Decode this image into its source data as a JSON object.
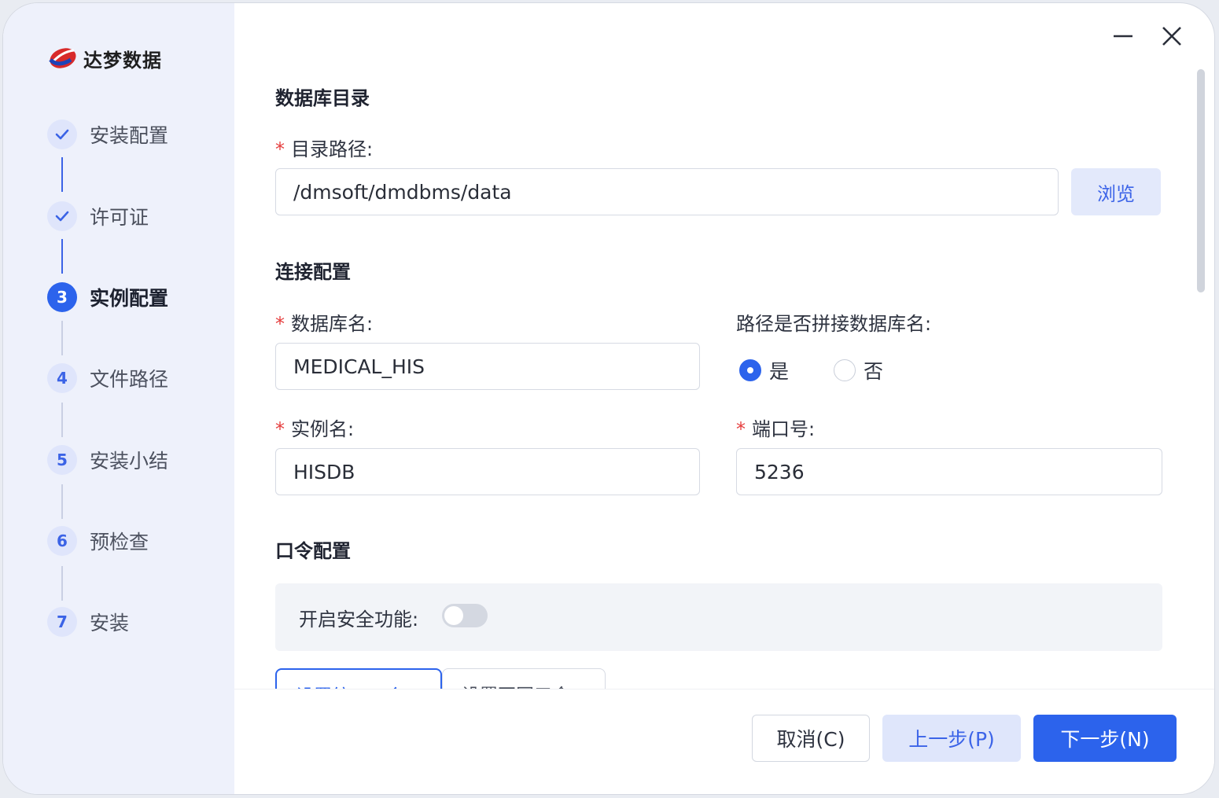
{
  "brand": {
    "name": "达梦数据"
  },
  "steps": [
    {
      "num": "1",
      "label": "安装配置",
      "state": "done"
    },
    {
      "num": "2",
      "label": "许可证",
      "state": "done"
    },
    {
      "num": "3",
      "label": "实例配置",
      "state": "active"
    },
    {
      "num": "4",
      "label": "文件路径",
      "state": "pending"
    },
    {
      "num": "5",
      "label": "安装小结",
      "state": "pending"
    },
    {
      "num": "6",
      "label": "预检查",
      "state": "pending"
    },
    {
      "num": "7",
      "label": "安装",
      "state": "pending"
    }
  ],
  "db_dir": {
    "title": "数据库目录",
    "path_label": "目录路径:",
    "path_value": "/dmsoft/dmdbms/data",
    "browse_label": "浏览"
  },
  "connection": {
    "title": "连接配置",
    "db_name_label": "数据库名:",
    "db_name_value": "MEDICAL_HIS",
    "append_label": "路径是否拼接数据库名:",
    "append_yes": "是",
    "append_no": "否",
    "append_selected": "是",
    "instance_label": "实例名:",
    "instance_value": "HISDB",
    "port_label": "端口号:",
    "port_value": "5236"
  },
  "password": {
    "title": "口令配置",
    "security_label": "开启安全功能:",
    "security_enabled": false,
    "tab_unified": "设置统一口令",
    "tab_separate": "设置不同口令"
  },
  "footer": {
    "cancel_label": "取消(C)",
    "prev_label": "上一步(P)",
    "next_label": "下一步(N)"
  },
  "colors": {
    "accent": "#2c63ec",
    "required": "#e53e3e",
    "sidebar_bg": "#eef1fb"
  },
  "icons": {
    "minimize": "minimize-icon",
    "close": "close-icon",
    "check": "check-icon"
  }
}
